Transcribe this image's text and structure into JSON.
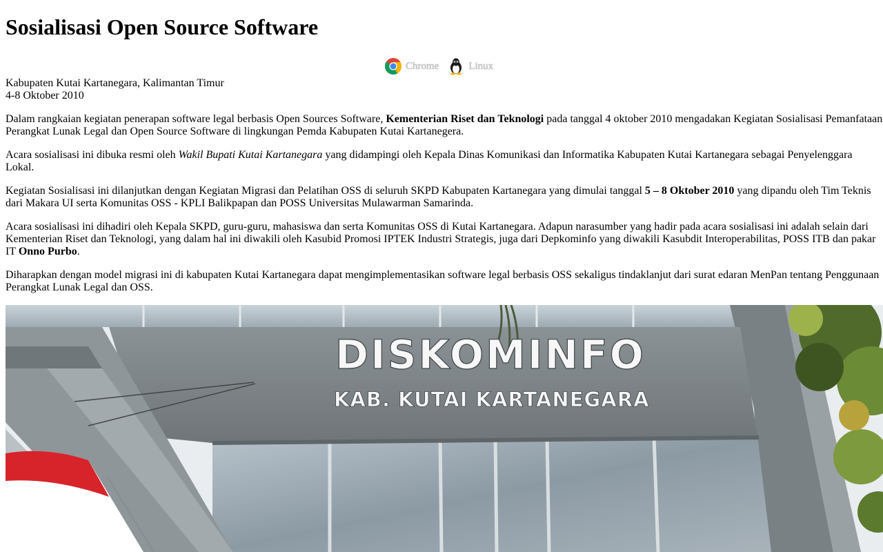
{
  "article": {
    "title": "Sosialisasi Open Source Software",
    "tags": [
      {
        "label": "Chrome",
        "icon": "chrome-icon"
      },
      {
        "label": "Linux",
        "icon": "linux-tux-icon"
      }
    ],
    "location": "Kabupaten Kutai Kartanegara, Kalimantan Timur",
    "date": "4-8 Oktober 2010",
    "p1": {
      "a": "Dalam rangkaian kegiatan penerapan software legal berbasis Open Sources Software, ",
      "b": "Kementerian Riset dan Teknologi",
      "c": " pada tanggal 4 oktober 2010 mengadakan Kegiatan Sosialisasi Pemanfataan Perangkat Lunak Legal dan Open Source Software di lingkungan Pemda Kabupaten Kutai Kartanegera."
    },
    "p2": {
      "a": "Acara sosialisasi ini dibuka resmi oleh ",
      "b": "Wakil Bupati Kutai Kartanegara",
      "c": " yang didampingi oleh Kepala Dinas Komunikasi dan Informatika Kabupaten Kutai Kartanegara sebagai Penyelenggara Lokal."
    },
    "p3": {
      "a": "Kegiatan Sosialisasi ini dilanjutkan dengan Kegiatan Migrasi dan Pelatihan OSS di seluruh SKPD Kabupaten Kartanegara yang dimulai tanggal ",
      "b": "5 – 8 Oktober 2010",
      "c": " yang dipandu oleh Tim Teknis dari Makara UI serta Komunitas OSS - KPLI Balikpapan dan POSS Universitas Mulawarman Samarinda."
    },
    "p4": {
      "a": "Acara sosialisasi ini dihadiri oleh Kepala SKPD, guru-guru, mahasiswa dan serta Komunitas OSS di Kutai Kartanegara. Adapun narasumber yang hadir pada acara sosialisasi ini adalah selain dari Kementerian Riset dan Teknologi, yang dalam hal ini diwakili oleh Kasubid Promosi IPTEK Industri Strategis, juga dari Depkominfo yang diwakili Kasubdit Interoperabilitas, POSS ITB dan pakar IT ",
      "b": "Onno Purbo",
      "c": "."
    },
    "p5": "Diharapkan dengan model migrasi ini di kabupaten Kutai Kartanegara dapat mengimplementasikan software legal berbasis OSS sekaligus tindaklanjut dari surat edaran MenPan tentang Penggunaan Perangkat Lunak Legal dan OSS.",
    "photo": {
      "sign_line1": "DISKOMINFO",
      "sign_line2": "KAB. KUTAI KARTANEGARA"
    }
  },
  "colors": {
    "text": "#000000",
    "tag_text": "#c6c6c6",
    "building_gray": "#7d8488",
    "sky": "#e9edf0",
    "flag_red": "#d6242a"
  }
}
